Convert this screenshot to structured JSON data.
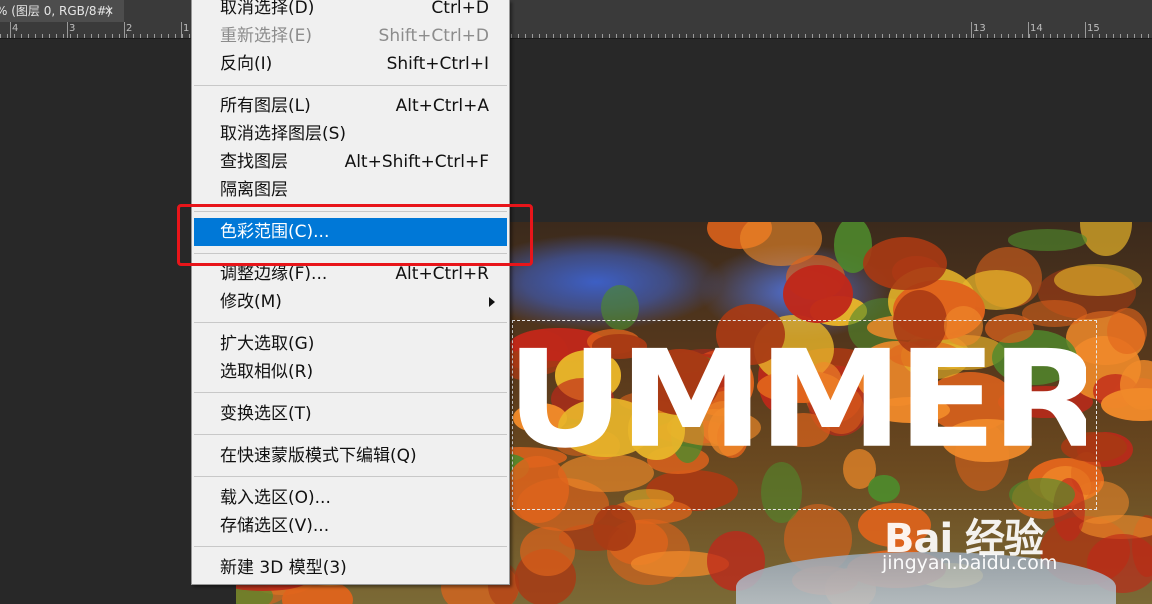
{
  "document_tab": {
    "title": "% (图层 0, RGB/8#)",
    "close_glyph": "✕"
  },
  "ruler": {
    "labels": [
      "4",
      "3",
      "2",
      "1",
      "13",
      "14",
      "15"
    ]
  },
  "canvas": {
    "headline": "UMMER",
    "colors": {
      "sky": "#3d5fc4",
      "leaves_orange": "#e0641c",
      "leaves_red": "#c0281a",
      "leaves_yellow": "#e8b52a",
      "green": "#4f8a2c"
    }
  },
  "menu": {
    "items": [
      {
        "label": "取消选择(D)",
        "shortcut": "Ctrl+D",
        "disabled": false
      },
      {
        "label": "重新选择(E)",
        "shortcut": "Shift+Ctrl+D",
        "disabled": true
      },
      {
        "label": "反向(I)",
        "shortcut": "Shift+Ctrl+I",
        "disabled": false
      },
      {
        "label": "所有图层(L)",
        "shortcut": "Alt+Ctrl+A",
        "disabled": false
      },
      {
        "label": "取消选择图层(S)",
        "shortcut": "",
        "disabled": false
      },
      {
        "label": "查找图层",
        "shortcut": "Alt+Shift+Ctrl+F",
        "disabled": false
      },
      {
        "label": "隔离图层",
        "shortcut": "",
        "disabled": false
      },
      {
        "label": "色彩范围(C)...",
        "shortcut": "",
        "disabled": false,
        "highlighted": true
      },
      {
        "label": "调整边缘(F)...",
        "shortcut": "Alt+Ctrl+R",
        "disabled": false
      },
      {
        "label": "修改(M)",
        "shortcut": "",
        "disabled": false,
        "submenu": true
      },
      {
        "label": "扩大选取(G)",
        "shortcut": "",
        "disabled": false
      },
      {
        "label": "选取相似(R)",
        "shortcut": "",
        "disabled": false
      },
      {
        "label": "变换选区(T)",
        "shortcut": "",
        "disabled": false
      },
      {
        "label": "在快速蒙版模式下编辑(Q)",
        "shortcut": "",
        "disabled": false
      },
      {
        "label": "载入选区(O)...",
        "shortcut": "",
        "disabled": false
      },
      {
        "label": "存储选区(V)...",
        "shortcut": "",
        "disabled": false
      },
      {
        "label": "新建 3D 模型(3)",
        "shortcut": "",
        "disabled": false
      }
    ],
    "highlight_color": "#0078d7",
    "annotation_color": "#e8151a"
  },
  "watermark": {
    "brand": "Bai 经验",
    "url": "jingyan.baidu.com"
  }
}
